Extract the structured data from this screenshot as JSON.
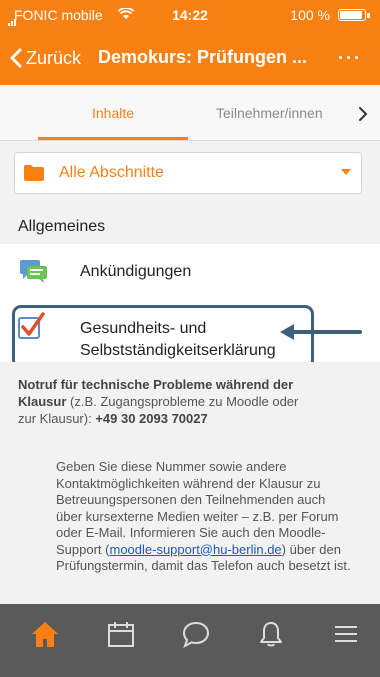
{
  "status_bar": {
    "carrier": "FONIC mobile",
    "time": "14:22",
    "battery": "100 %"
  },
  "nav": {
    "back_label": "Zurück",
    "title": "Demokurs: Prüfungen ...",
    "more_label": "···"
  },
  "tabs": [
    {
      "label": "Inhalte",
      "active": true
    },
    {
      "label": "Teilnehmer/innen",
      "active": false
    }
  ],
  "section_select": {
    "selected": "Alle Abschnitte"
  },
  "section": {
    "heading": "Allgemeines",
    "items": [
      {
        "label": "Ankündigungen",
        "icon": "forum-icon"
      },
      {
        "label_line1": "Gesundheits- und",
        "label_line2": "Selbstständigkeitserklärung",
        "icon": "checkbox-check-icon"
      }
    ]
  },
  "notice": {
    "bold_lead": "Notruf für technische Probleme während der Klausur",
    "lead_rest": " (z.B. Zugangsprobleme zu Moodle oder zur Klausur): ",
    "phone": "+49 30 2093 70027",
    "para_before_link": "Geben Sie diese Nummer sowie andere Kontaktmöglichkeiten während der Klausur zu Betreuungspersonen den Teilnehmenden auch über kursexterne Medien weiter – z.B. per Forum oder E-Mail. Informieren Sie auch den Moodle-Support (",
    "link_text": "moodle-support@hu-berlin.de",
    "para_after_link": ") über den Prüfungstermin, damit das Telefon auch besetzt ist."
  },
  "tabbar": [
    "home-icon",
    "calendar-icon",
    "chat-icon",
    "bell-icon",
    "menu-icon"
  ],
  "colors": {
    "brand": "#f98012",
    "highlight": "#3d607d",
    "tabbar": "#5a5a5a",
    "link": "#1a5bb6"
  }
}
